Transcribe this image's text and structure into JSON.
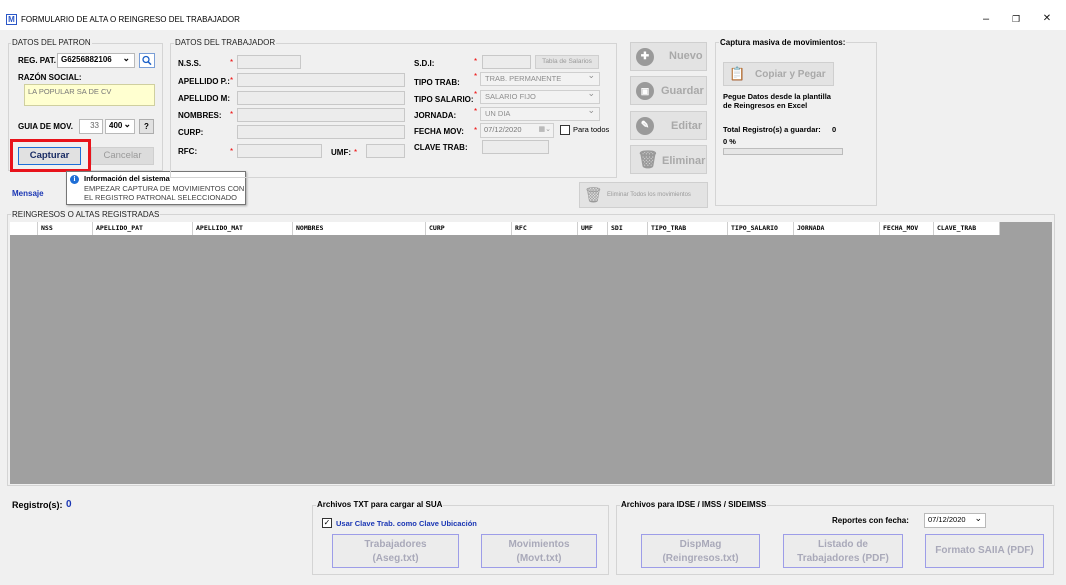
{
  "window": {
    "title": "FORMULARIO DE ALTA O REINGRESO DEL TRABAJADOR",
    "icon": "app-icon",
    "minimize": "–",
    "restore": "❐",
    "close": "✕"
  },
  "patron": {
    "group": "DATOS DEL PATRON",
    "reg_label": "REG. PAT.",
    "reg_value": "G6256882106",
    "razon_label": "RAZÓN SOCIAL:",
    "razon_value": "LA POPULAR SA DE CV",
    "guia_label": "GUIA DE MOV.",
    "guia_num": "33",
    "guia_sel": "400",
    "help": "?",
    "capturar": "Capturar",
    "cancelar": "Cancelar",
    "mensaje": "Mensaje"
  },
  "trabajador": {
    "group": "DATOS DEL TRABAJADOR",
    "nss": "N.S.S.",
    "apellido_p": "APELLIDO P.:",
    "apellido_m": "APELLIDO M:",
    "nombres": "NOMBRES:",
    "curp": "CURP:",
    "rfc": "RFC:",
    "umf": "UMF:",
    "sdi": "S.D.I:",
    "tabla_salarios": "Tabla de Salarios",
    "tipo_trab": "TIPO TRAB:",
    "tipo_trab_value": "TRAB. PERMANENTE",
    "tipo_salario": "TIPO SALARIO:",
    "tipo_salario_value": "SALARIO FIJO",
    "jornada": "JORNADA:",
    "jornada_value": "UN DIA",
    "fecha_mov": "FECHA MOV:",
    "fecha_value": "07/12/2020",
    "para_todos": "Para todos",
    "clave_trab": "CLAVE TRAB:"
  },
  "actions": {
    "nuevo": "Nuevo",
    "guardar": "Guardar",
    "editar": "Editar",
    "eliminar": "Eliminar",
    "eliminar_todos": "Eliminar Todos los movimientos"
  },
  "masiva": {
    "title": "Captura masiva de movimientos:",
    "copiar": "Copiar y Pegar",
    "desc1": "Pegue Datos desde la plantilla",
    "desc2": "de Reingresos en Excel",
    "total_label": "Total Registro(s) a guardar:",
    "total": "0",
    "percent": "0 %",
    "progress": 0
  },
  "tooltip": {
    "title": "Información del sistema",
    "line1": "EMPEZAR CAPTURA DE MOVIMIENTOS CON",
    "line2": "EL REGISTRO PATRONAL SELECCIONADO"
  },
  "table": {
    "group": "REINGRESOS O ALTAS REGISTRADAS",
    "columns": [
      "NSS",
      "APELLIDO_PAT",
      "APELLIDO_MAT",
      "NOMBRES",
      "CURP",
      "RFC",
      "UMF",
      "SDI",
      "TIPO_TRAB",
      "TIPO_SALARIO",
      "JORNADA",
      "FECHA_MOV",
      "CLAVE_TRAB"
    ]
  },
  "footer": {
    "registros_label": "Registro(s):",
    "registros": "0",
    "txt_title": "Archivos  TXT para cargar al SUA",
    "usar_clave": "Usar Clave Trab. como Clave Ubicación",
    "trab1": "Trabajadores",
    "trab2": "(Aseg.txt)",
    "mov1": "Movimientos",
    "mov2": "(Movt.txt)",
    "idse_title": "Archivos para IDSE / IMSS / SIDEIMSS",
    "reportes": "Reportes con fecha:",
    "reportes_fecha": "07/12/2020",
    "disp1": "DispMag",
    "disp2": "(Reingresos.txt)",
    "lis1": "Listado de",
    "lis2": "Trabajadores (PDF)",
    "sai": "Formato SAIIA (PDF)"
  },
  "colors": {
    "highlight": "#e8131b",
    "link_blue": "#1a36b4",
    "info_blue": "#1e6ed6"
  }
}
